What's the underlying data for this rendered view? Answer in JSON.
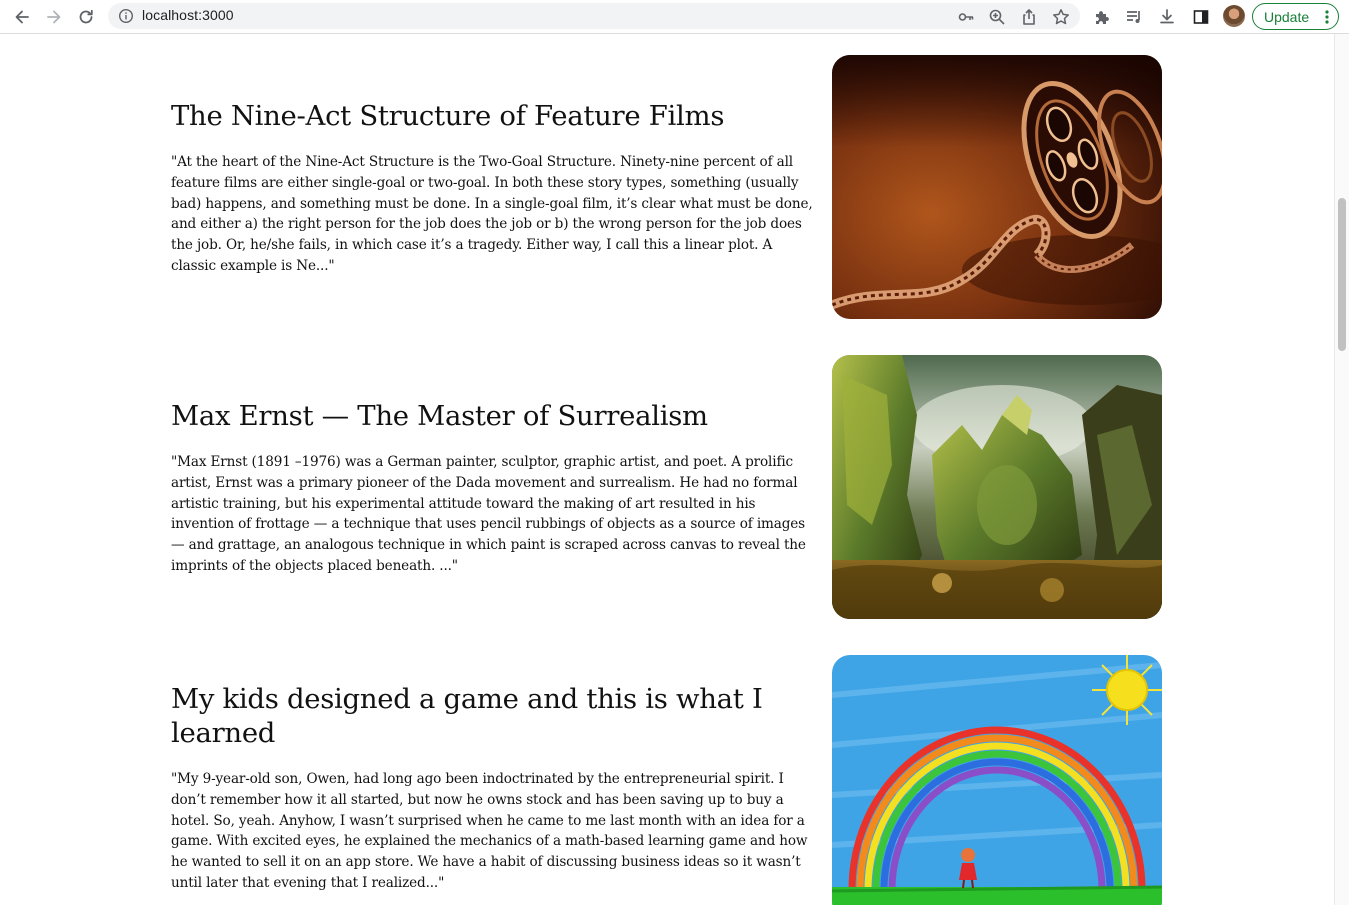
{
  "browser": {
    "url": "localhost:3000",
    "update_label": "Update"
  },
  "articles": [
    {
      "title": "The Nine-Act Structure of Feature Films",
      "excerpt": "\"At the heart of the Nine-Act Structure is the Two-Goal Structure. Ninety-nine percent of all feature films are either single-goal or two-goal. In both these story types, something (usually bad) happens, and something must be done. In a single-goal film, it’s clear what must be done, and either a) the right person for the job does the job or b) the wrong person for the job does the job. Or, he/she fails, in which case it’s a tragedy. Either way, I call this a linear plot. A classic example is Ne...\""
    },
    {
      "title": "Max Ernst — The Master of Surrealism",
      "excerpt": "\"Max Ernst (1891 –1976) was a German painter, sculptor, graphic artist, and poet. A prolific artist, Ernst was a primary pioneer of the Dada movement and surrealism. He had no formal artistic training, but his experimental attitude toward the making of art resulted in his invention of frottage — a technique that uses pencil rubbings of objects as a source of images — and grattage, an analogous technique in which paint is scraped across canvas to reveal the imprints of the objects placed beneath. ...\""
    },
    {
      "title": "My kids designed a game and this is what I learned",
      "excerpt": "\"My 9-year-old son, Owen, had long ago been indoctrinated by the entrepreneurial spirit. I don’t remember how it all started, but now he owns stock and has been saving up to buy a hotel. So, yeah. Anyhow, I wasn’t surprised when he came to me last month with an idea for a game. With excited eyes, he explained the mechanics of a math-based learning game and how he wanted to sell it on an app store. We have a habit of discussing business ideas so it wasn’t until later that evening that I realized...\""
    }
  ]
}
